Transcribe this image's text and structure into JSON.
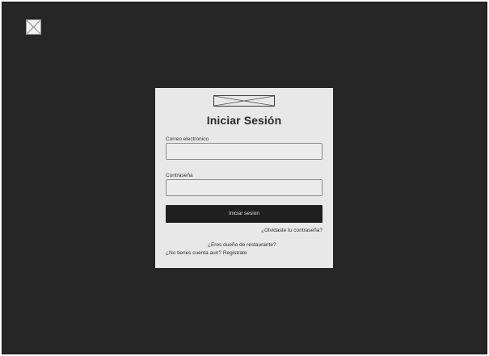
{
  "login": {
    "title": "Iniciar Sesión",
    "email_label": "Correo electronico",
    "email_value": "",
    "email_placeholder": "",
    "password_label": "Contraseña",
    "password_value": "",
    "password_placeholder": "",
    "submit_label": "Iniciar sesion",
    "forgot_password_link": "¿Olvidaste tu contraseña?",
    "restaurant_owner_link": "¿Eres dueño de restaurante?",
    "register_link": "¿No tienes cuenta aun? Registrate"
  },
  "icons": {
    "corner": "image-placeholder-icon",
    "logo": "logo-placeholder-icon"
  },
  "colors": {
    "background": "#262626",
    "card": "#e8e8e8",
    "button": "#1f1f1f"
  }
}
